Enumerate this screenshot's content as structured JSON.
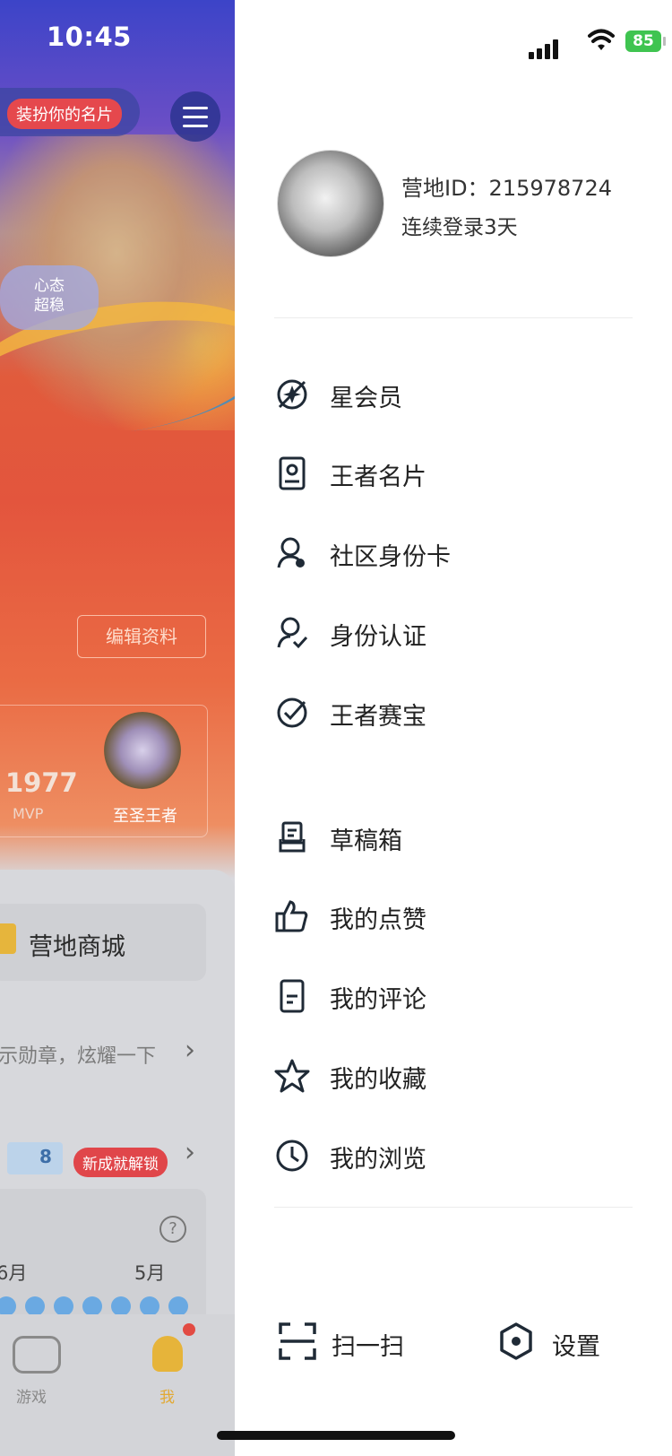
{
  "status_bar": {
    "time": "10:45",
    "battery": "85"
  },
  "background_page": {
    "decorate_card_label": "装扮你的名片",
    "bubble_text_line1": "心态",
    "bubble_text_line2": "超稳",
    "edit_profile_button": "编辑资料",
    "stat_value": "1977",
    "stat_label": "MVP",
    "rank_label": "至圣王者",
    "shop_label": "营地商城",
    "medal_text": "示勋章，炫耀一下",
    "badge_count": "8",
    "unlock_badge": "新成就解锁",
    "month_6": "6月",
    "month_5": "5月",
    "tabs": [
      {
        "label": "游戏"
      },
      {
        "label": "我"
      }
    ]
  },
  "drawer": {
    "user_id": "营地ID：215978724",
    "login_streak": "连续登录3天",
    "menu_group_1": [
      {
        "label": "星会员",
        "icon": "star-member-icon"
      },
      {
        "label": "王者名片",
        "icon": "profile-card-icon"
      },
      {
        "label": "社区身份卡",
        "icon": "community-id-icon"
      },
      {
        "label": "身份认证",
        "icon": "identity-verify-icon"
      },
      {
        "label": "王者赛宝",
        "icon": "check-circle-icon"
      }
    ],
    "menu_group_2": [
      {
        "label": "草稿箱",
        "icon": "drafts-icon"
      },
      {
        "label": "我的点赞",
        "icon": "thumbs-up-icon"
      },
      {
        "label": "我的评论",
        "icon": "comment-doc-icon"
      },
      {
        "label": "我的收藏",
        "icon": "star-outline-icon"
      },
      {
        "label": "我的浏览",
        "icon": "clock-icon"
      }
    ],
    "bottom": {
      "scan_label": "扫一扫",
      "settings_label": "设置"
    }
  }
}
